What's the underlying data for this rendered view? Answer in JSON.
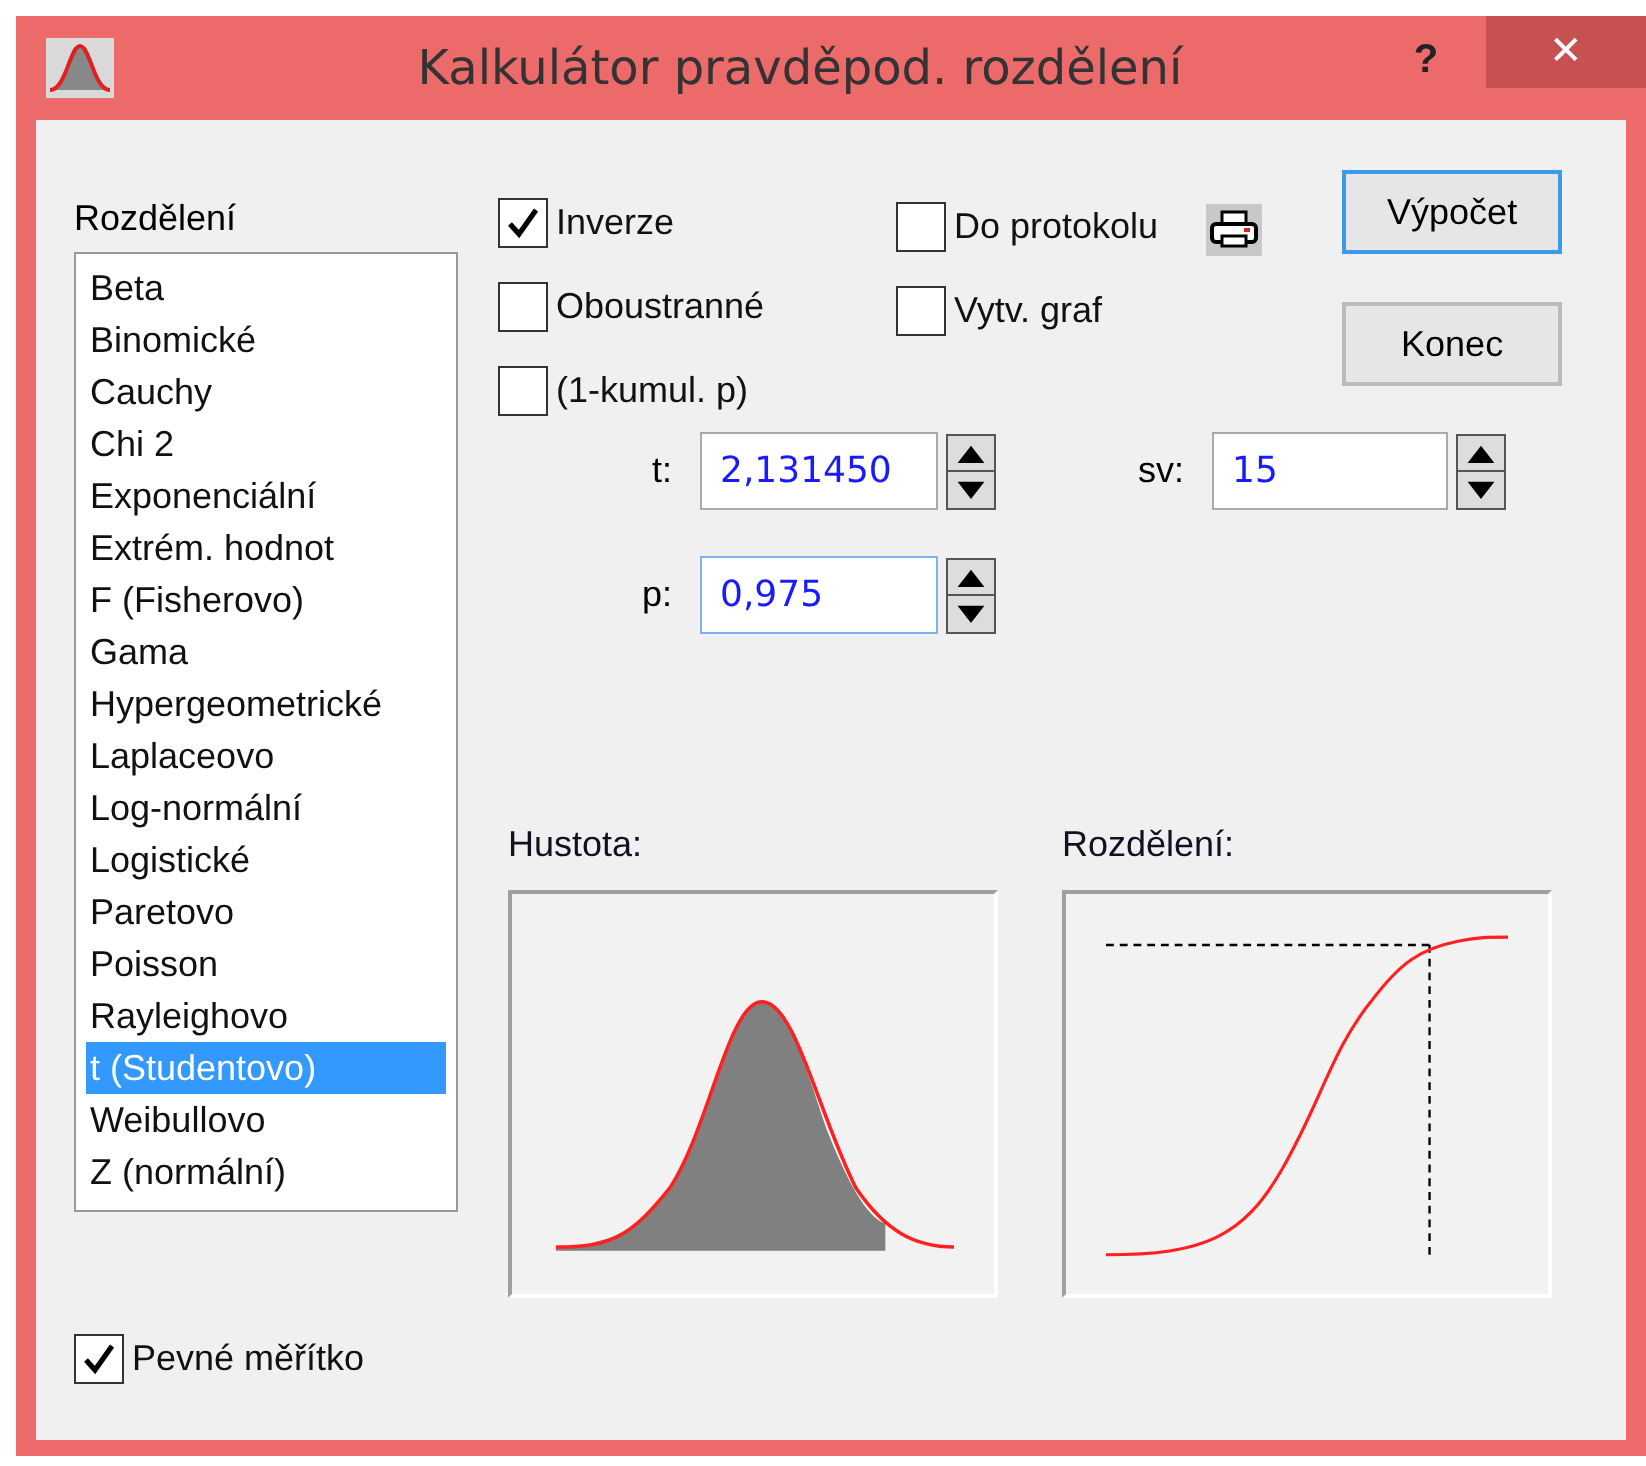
{
  "window": {
    "title": "Kalkulátor pravděpod. rozdělení",
    "help": "?",
    "close": "✕"
  },
  "distributions": {
    "label": "Rozdělení",
    "items": [
      {
        "label": "Beta",
        "selected": false
      },
      {
        "label": "Binomické",
        "selected": false
      },
      {
        "label": "Cauchy",
        "selected": false
      },
      {
        "label": "Chi 2",
        "selected": false
      },
      {
        "label": "Exponenciální",
        "selected": false
      },
      {
        "label": "Extrém. hodnot",
        "selected": false
      },
      {
        "label": "F (Fisherovo)",
        "selected": false
      },
      {
        "label": "Gama",
        "selected": false
      },
      {
        "label": "Hypergeometrické",
        "selected": false
      },
      {
        "label": "Laplaceovo",
        "selected": false
      },
      {
        "label": "Log-normální",
        "selected": false
      },
      {
        "label": "Logistické",
        "selected": false
      },
      {
        "label": "Paretovo",
        "selected": false
      },
      {
        "label": "Poisson",
        "selected": false
      },
      {
        "label": "Rayleighovo",
        "selected": false
      },
      {
        "label": "t (Studentovo)",
        "selected": true
      },
      {
        "label": "Weibullovo",
        "selected": false
      },
      {
        "label": "Z (normální)",
        "selected": false
      }
    ]
  },
  "fixed_scale": {
    "label": "Pevné měřítko",
    "checked": true
  },
  "options_left": [
    {
      "label": "Inverze",
      "checked": true
    },
    {
      "label": "Oboustranné",
      "checked": false
    },
    {
      "label": "(1-kumul. p)",
      "checked": false
    }
  ],
  "options_right": [
    {
      "label": "Do protokolu",
      "checked": false
    },
    {
      "label": "Vytv. graf",
      "checked": false
    }
  ],
  "buttons": [
    {
      "label": "Výpočet",
      "focused": true
    },
    {
      "label": "Konec",
      "focused": false
    }
  ],
  "fields": {
    "t": {
      "label": "t:",
      "value": "2,131450",
      "focused": false
    },
    "sv": {
      "label": "sv:",
      "value": "15",
      "focused": false
    },
    "p": {
      "label": "p:",
      "value": "0,975",
      "focused": true
    }
  },
  "plots": {
    "density_label": "Hustota:",
    "cdf_label": "Rozdělení:"
  }
}
